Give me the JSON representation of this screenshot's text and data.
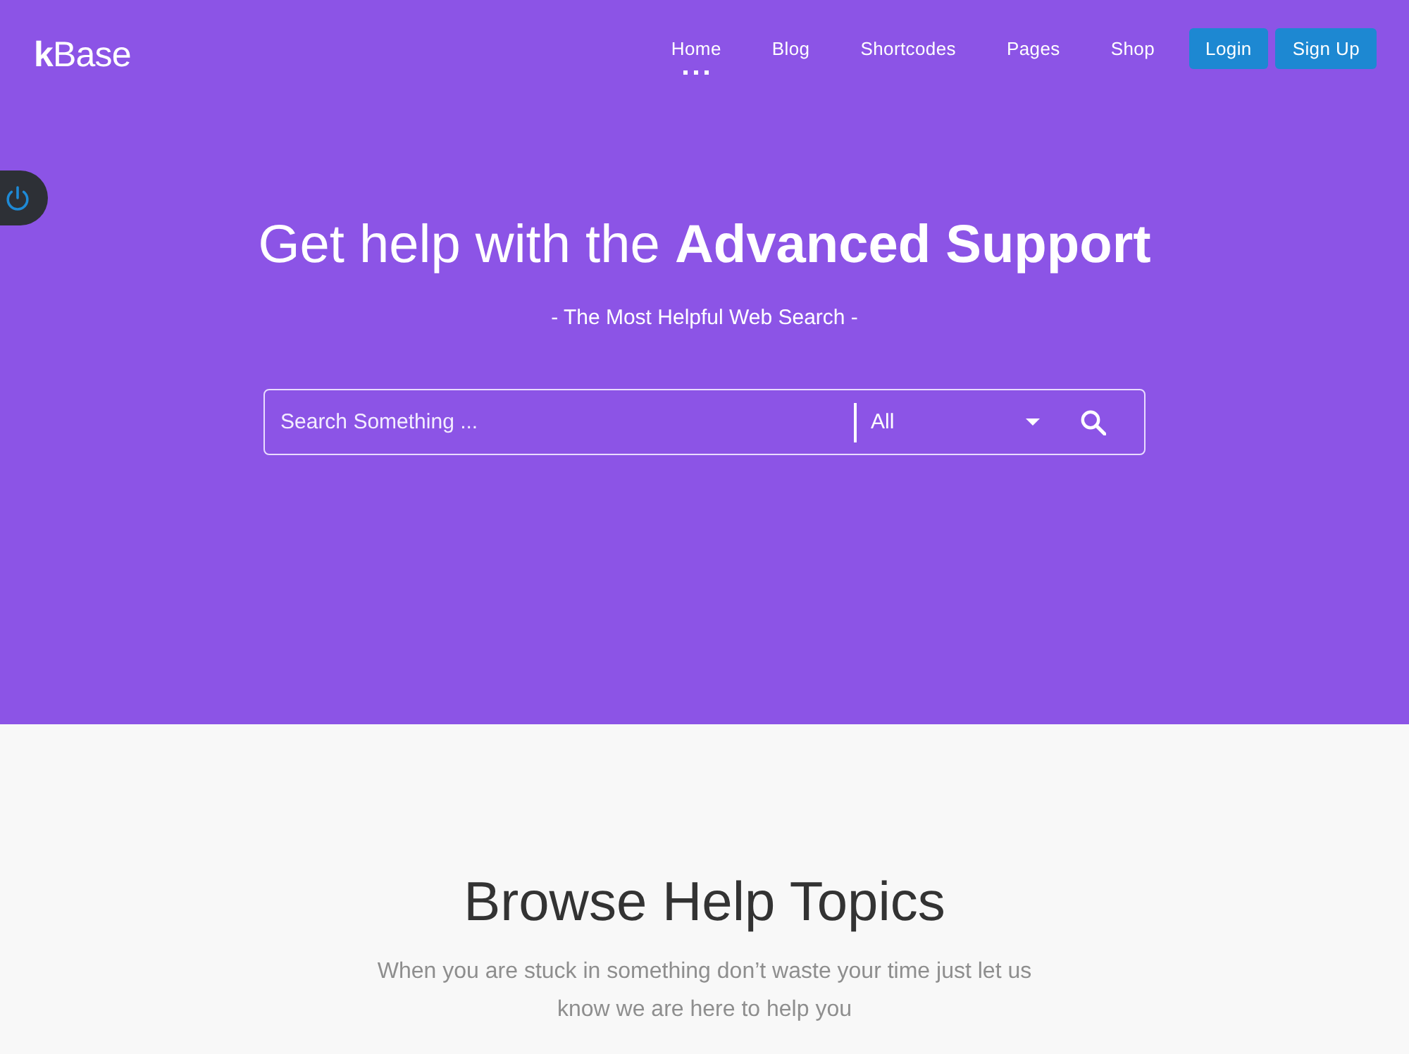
{
  "header": {
    "logo": "**k**Base",
    "nav": [
      {
        "label": "Home",
        "selected": true
      },
      {
        "label": "Blog",
        "selected": false
      },
      {
        "label": "Shortcodes",
        "selected": false
      },
      {
        "label": "Pages",
        "selected": false
      },
      {
        "label": "Shop",
        "selected": false
      }
    ],
    "buttons": [
      "Login",
      "Sign Up"
    ]
  },
  "hero": {
    "title": "Get help with the **Advanced Support**",
    "subtitle": "- The Most Helpful Web Search -",
    "search": {
      "placeholder": "Search Something ...",
      "category": "All"
    }
  },
  "topics": {
    "title": "Browse Help Topics",
    "text": "When you are stuck in something don’t waste your time just let us know we are here to help you"
  }
}
